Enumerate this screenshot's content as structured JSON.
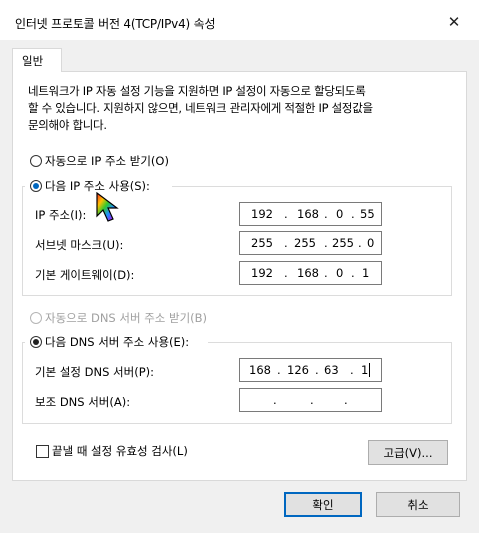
{
  "window": {
    "title": "인터넷 프로토콜 버전 4(TCP/IPv4) 속성",
    "close_glyph": "✕"
  },
  "tab": {
    "label": "일반"
  },
  "description": [
    "네트워크가 IP 자동 설정 기능을 지원하면 IP 설정이 자동으로 할당되도록",
    "할 수 있습니다. 지원하지 않으면, 네트워크 관리자에게 적절한 IP 설정값을",
    "문의해야 합니다."
  ],
  "ip": {
    "auto_label": "자동으로 IP 주소 받기(O)",
    "manual_label": "다음 IP 주소 사용(S):",
    "selected": "manual",
    "fields": [
      {
        "label": "IP 주소(I):",
        "octets": [
          "192",
          "168",
          "0",
          "55"
        ]
      },
      {
        "label": "서브넷 마스크(U):",
        "octets": [
          "255",
          "255",
          "255",
          "0"
        ]
      },
      {
        "label": "기본 게이트웨이(D):",
        "octets": [
          "192",
          "168",
          "0",
          "1"
        ]
      }
    ]
  },
  "dns": {
    "auto_label": "자동으로 DNS 서버 주소 받기(B)",
    "manual_label": "다음 DNS 서버 주소 사용(E):",
    "selected": "manual",
    "fields": [
      {
        "label": "기본 설정 DNS 서버(P):",
        "octets": [
          "168",
          "126",
          "63",
          "1"
        ]
      },
      {
        "label": "보조 DNS 서버(A):",
        "octets": [
          "",
          "",
          "",
          ""
        ]
      }
    ]
  },
  "validate": {
    "label": "끝낼 때 설정 유효성 검사(L)",
    "checked": false
  },
  "buttons": {
    "advanced": "고급(V)...",
    "ok": "확인",
    "cancel": "취소"
  },
  "colors": {
    "accent": "#0067c0"
  }
}
